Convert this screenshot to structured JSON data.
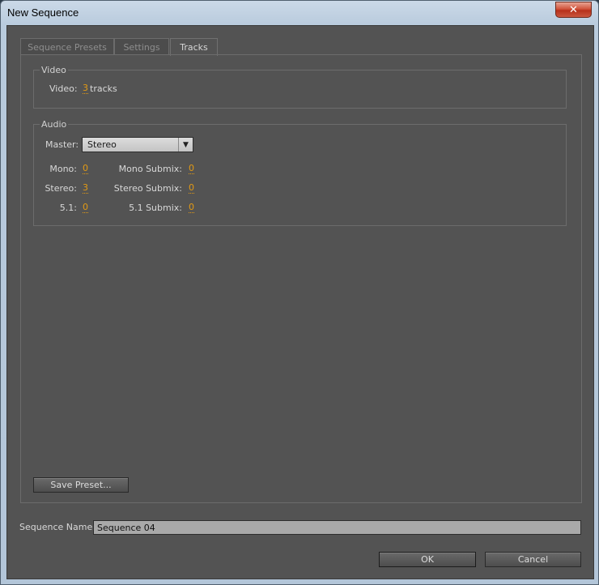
{
  "window": {
    "title": "New Sequence",
    "close_glyph": "✕"
  },
  "tabs": [
    {
      "label": "Sequence Presets"
    },
    {
      "label": "Settings"
    },
    {
      "label": "Tracks"
    }
  ],
  "video": {
    "group_title": "Video",
    "label": "Video:",
    "count": "3",
    "suffix": "tracks"
  },
  "audio": {
    "group_title": "Audio",
    "master_label": "Master:",
    "master_value": "Stereo",
    "mono_label": "Mono:",
    "mono_value": "0",
    "stereo_label": "Stereo:",
    "stereo_value": "3",
    "five_one_label": "5.1:",
    "five_one_value": "0",
    "mono_submix_label": "Mono Submix:",
    "mono_submix_value": "0",
    "stereo_submix_label": "Stereo Submix:",
    "stereo_submix_value": "0",
    "five_one_submix_label": "5.1 Submix:",
    "five_one_submix_value": "0"
  },
  "save_preset_label": "Save Preset...",
  "sequence_name": {
    "label": "Sequence Name:",
    "value": "Sequence 04"
  },
  "ok_label": "OK",
  "cancel_label": "Cancel",
  "colors": {
    "panel": "#535353",
    "accent_value": "#e29a15"
  },
  "icons": {
    "dropdown": "chevron-down-icon",
    "close": "close-icon"
  }
}
